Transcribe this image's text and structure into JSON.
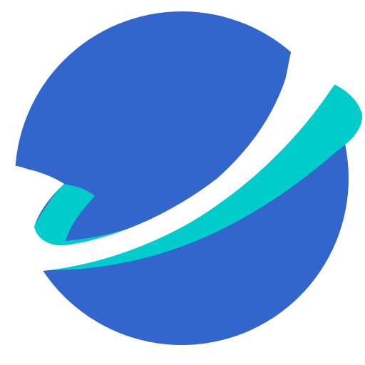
{
  "logo": {
    "icon": "planet-ring-logo-icon",
    "colors": {
      "background": "#ffffff",
      "planet": "#3366cc",
      "ring_teal": "#00cccc",
      "ring_white": "#ffffff"
    }
  }
}
